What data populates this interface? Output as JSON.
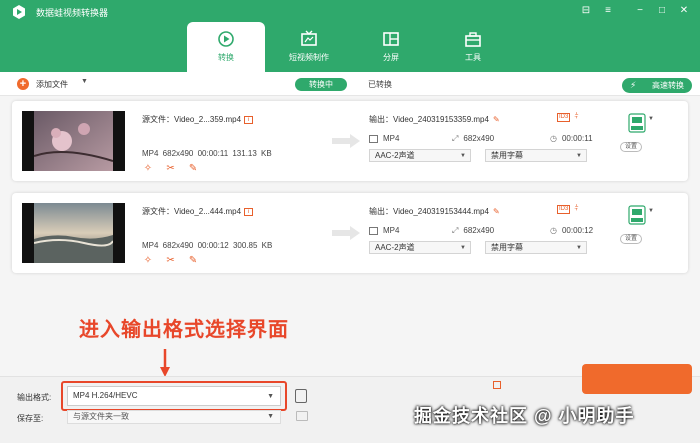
{
  "app": {
    "title": "数据蛙视频转换器"
  },
  "tabs": [
    {
      "label": "转换",
      "icon": "convert-icon",
      "active": true
    },
    {
      "label": "短视频制作",
      "icon": "tv-icon"
    },
    {
      "label": "分屏",
      "icon": "split-screen-icon"
    },
    {
      "label": "工具",
      "icon": "toolbox-icon"
    }
  ],
  "toolbar": {
    "add_label": "添加文件",
    "seg_converting": "转换中",
    "seg_converted": "已转换",
    "fast_label": "高速转换"
  },
  "files": [
    {
      "source": "源文件：Video_2...359.mp4",
      "meta": "MP4  682x490  00:00:11  131.13 KB",
      "output": "输出：Video_240319153359.mp4",
      "out_format": "MP4",
      "out_res": "682x490",
      "out_dur": "00:00:11",
      "audio": "AAC-2声道",
      "subtitle": "禁用字幕",
      "settings": "设置"
    },
    {
      "source": "源文件：Video_2...444.mp4",
      "meta": "MP4  682x490  00:00:12  300.85 KB",
      "output": "输出：Video_240319153444.mp4",
      "out_format": "MP4",
      "out_res": "682x490",
      "out_dur": "00:00:12",
      "audio": "AAC-2声道",
      "subtitle": "禁用字幕",
      "settings": "设置"
    }
  ],
  "bottom": {
    "format_label": "输出格式:",
    "format_value": "MP4 H.264/HEVC",
    "save_label": "保存至:",
    "save_value": "与源文件夹一致"
  },
  "annotation": "进入输出格式选择界面",
  "watermark": "掘金技术社区 @ 小明助手",
  "colors": {
    "brand": "#2fa96c",
    "accent": "#f06a2c",
    "annotation": "#e8472a"
  }
}
